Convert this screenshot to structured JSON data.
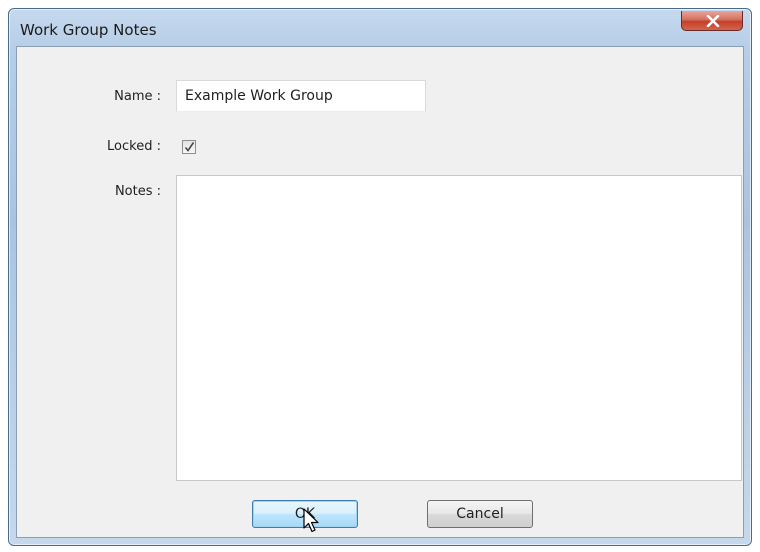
{
  "window": {
    "title": "Work Group Notes",
    "close_icon": "close-icon"
  },
  "form": {
    "name_label": "Name :",
    "name_value": "Example Work Group",
    "locked_label": "Locked :",
    "locked_checked": true,
    "notes_label": "Notes :",
    "notes_value": ""
  },
  "buttons": {
    "ok_label": "OK",
    "cancel_label": "Cancel"
  },
  "cursor": "arrow-pointer-icon"
}
